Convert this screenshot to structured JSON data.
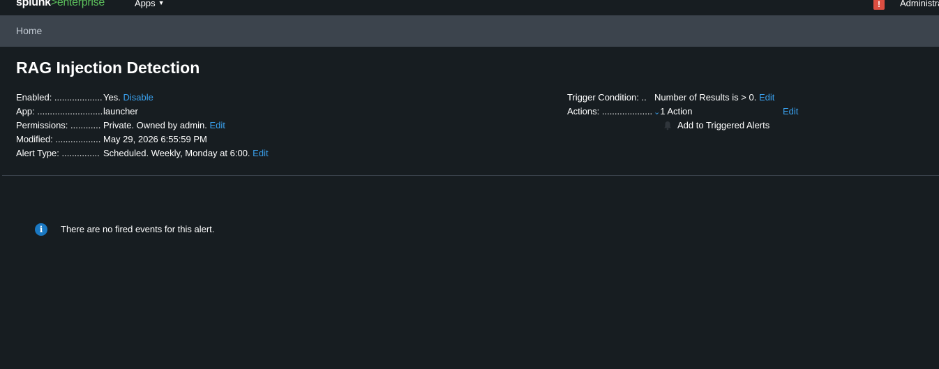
{
  "topbar": {
    "logo_primary": "splunk",
    "logo_gt": ">",
    "logo_secondary": "enterprise",
    "apps_label": "Apps",
    "alert_badge": "!",
    "user_label": "Administrator"
  },
  "breadcrumb": {
    "home": "Home"
  },
  "alert": {
    "title": "RAG Injection Detection",
    "enabled_label": "Enabled: ....................",
    "enabled_value": "Yes.",
    "enabled_action": "Disable",
    "app_label": "App: ...........................",
    "app_value": "launcher",
    "permissions_label": "Permissions: ............",
    "permissions_value": "Private. Owned by admin.",
    "permissions_action": "Edit",
    "modified_label": "Modified: ..................",
    "modified_value": "May 29, 2026 6:55:59 PM",
    "alert_type_label": "Alert Type: ...............",
    "alert_type_value": "Scheduled. Weekly, Monday at 6:00.",
    "alert_type_action": "Edit",
    "trigger_label": "Trigger Condition: ..",
    "trigger_value": "Number of Results is > 0.",
    "trigger_action": "Edit",
    "actions_label": "Actions: ....................",
    "actions_value": "1 Action",
    "actions_action": "Edit",
    "action_item": "Add to Triggered Alerts"
  },
  "events": {
    "empty_message": "There are no fired events for this alert."
  },
  "icons": {
    "info": "info-icon",
    "bell": "bell-icon",
    "chevron": "chevron-down-icon"
  },
  "colors": {
    "background": "#171d21",
    "breadcrumb_bar": "#3c444d",
    "link": "#3aa2f0",
    "logo_green": "#5cc05c",
    "alert_red": "#dc4e41"
  }
}
